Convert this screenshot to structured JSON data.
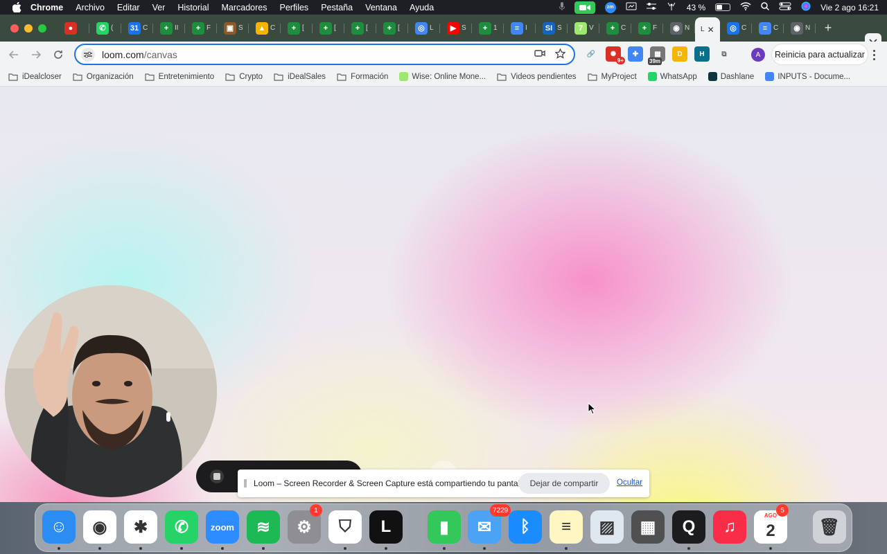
{
  "menubar": {
    "app_name": "Chrome",
    "items": [
      "Archivo",
      "Editar",
      "Ver",
      "Historial",
      "Marcadores",
      "Perfiles",
      "Pestaña",
      "Ventana",
      "Ayuda"
    ],
    "battery": "43 %",
    "battery_level": 0.43,
    "clock": "Vie 2 ago 16:21",
    "zoom_label": "zm"
  },
  "tabs": [
    {
      "glyph": "●",
      "color": "#d93025",
      "label": ""
    },
    {
      "glyph": "✆",
      "color": "#25d366",
      "label": "("
    },
    {
      "glyph": "31",
      "color": "#1a73e8",
      "label": "C"
    },
    {
      "glyph": "+",
      "color": "#1e8e3e",
      "label": "II"
    },
    {
      "glyph": "+",
      "color": "#1e8e3e",
      "label": "F"
    },
    {
      "glyph": "▣",
      "color": "#8a5a2b",
      "label": "S"
    },
    {
      "glyph": "▲",
      "color": "#f4b400",
      "label": "C"
    },
    {
      "glyph": "+",
      "color": "#1e8e3e",
      "label": "["
    },
    {
      "glyph": "+",
      "color": "#1e8e3e",
      "label": "["
    },
    {
      "glyph": "+",
      "color": "#1e8e3e",
      "label": "["
    },
    {
      "glyph": "+",
      "color": "#1e8e3e",
      "label": "["
    },
    {
      "glyph": "◎",
      "color": "#4285f4",
      "label": "L"
    },
    {
      "glyph": "▶",
      "color": "#ff0000",
      "label": "S"
    },
    {
      "glyph": "+",
      "color": "#1e8e3e",
      "label": "1"
    },
    {
      "glyph": "≡",
      "color": "#4285f4",
      "label": "I"
    },
    {
      "glyph": "SI",
      "color": "#1565c0",
      "label": "S"
    },
    {
      "glyph": "7",
      "color": "#9fe870",
      "label": "V"
    },
    {
      "glyph": "+",
      "color": "#1e8e3e",
      "label": "C"
    },
    {
      "glyph": "+",
      "color": "#1e8e3e",
      "label": "F"
    },
    {
      "glyph": "◉",
      "color": "#5f6368",
      "label": "N"
    }
  ],
  "active_tab": {
    "label": "L",
    "close": "✕"
  },
  "tabs_after": [
    {
      "glyph": "◎",
      "color": "#1a73e8",
      "label": "C"
    },
    {
      "glyph": "≡",
      "color": "#4285f4",
      "label": "C"
    },
    {
      "glyph": "◉",
      "color": "#5f6368",
      "label": "N"
    }
  ],
  "address": {
    "host": "loom.com",
    "path": "/canvas"
  },
  "extensions": [
    {
      "glyph": "🔗",
      "color": "#1a73e8",
      "badge": ""
    },
    {
      "glyph": "✺",
      "color": "#d93025",
      "badge": "9+"
    },
    {
      "glyph": "✚",
      "color": "#4285f4",
      "badge": ""
    },
    {
      "glyph": "▦",
      "color": "#777777",
      "badge": "39m"
    },
    {
      "glyph": "D",
      "color": "#f4b400",
      "badge": ""
    },
    {
      "glyph": "H",
      "color": "#0b6e8a",
      "badge": ""
    },
    {
      "glyph": "⧉",
      "color": "#5f6368",
      "badge": ""
    }
  ],
  "profile_initial": "A",
  "update_button": "Reinicia para actualizar",
  "bookmarks": [
    {
      "label": "iDealcloser",
      "type": "folder",
      "color": ""
    },
    {
      "label": "Organización",
      "type": "folder",
      "color": ""
    },
    {
      "label": "Entretenimiento",
      "type": "folder",
      "color": ""
    },
    {
      "label": "Crypto",
      "type": "folder",
      "color": ""
    },
    {
      "label": "iDealSales",
      "type": "folder",
      "color": ""
    },
    {
      "label": "Formación",
      "type": "folder",
      "color": ""
    },
    {
      "label": "Wise: Online Mone...",
      "type": "site",
      "color": "#9fe870"
    },
    {
      "label": "Videos pendientes",
      "type": "folder",
      "color": ""
    },
    {
      "label": "MyProject",
      "type": "folder",
      "color": ""
    },
    {
      "label": "WhatsApp",
      "type": "site",
      "color": "#25d366"
    },
    {
      "label": "Dashlane",
      "type": "site",
      "color": "#0e353d"
    },
    {
      "label": "INPUTS - Docume...",
      "type": "site",
      "color": "#4285f4"
    }
  ],
  "share_notice": {
    "message": "Loom – Screen Recorder & Screen Capture está compartiendo tu pantalla.",
    "stop_button": "Dejar de compartir",
    "hide_link": "Ocultar"
  },
  "dock": [
    {
      "name": "finder-icon",
      "bg": "#2b8cf2",
      "glyph": "☺",
      "badge": "",
      "running": true
    },
    {
      "name": "chrome-icon",
      "bg": "#ffffff",
      "glyph": "◉",
      "badge": "",
      "running": true
    },
    {
      "name": "slack-icon",
      "bg": "#ffffff",
      "glyph": "✱",
      "badge": "",
      "running": true
    },
    {
      "name": "whatsapp-icon",
      "bg": "#25d366",
      "glyph": "✆",
      "badge": "",
      "running": true
    },
    {
      "name": "zoom-icon",
      "bg": "#2d8cff",
      "glyph": "zoom",
      "badge": "",
      "running": true
    },
    {
      "name": "spotify-icon",
      "bg": "#1db954",
      "glyph": "≋",
      "badge": "",
      "running": true
    },
    {
      "name": "system-settings-icon",
      "bg": "#8e8e93",
      "glyph": "⚙",
      "badge": "1",
      "running": false
    },
    {
      "name": "security-shield-icon",
      "bg": "#ffffff",
      "glyph": "⛉",
      "badge": "",
      "running": true
    },
    {
      "name": "loom-app-icon",
      "bg": "#111111",
      "glyph": "L",
      "badge": "",
      "running": true
    },
    {
      "name": "numbers-icon",
      "bg": "#34c759",
      "glyph": "▮",
      "badge": "",
      "running": true
    },
    {
      "name": "mail-icon",
      "bg": "#4aa3f5",
      "glyph": "✉",
      "badge": "7229",
      "running": true
    },
    {
      "name": "bluetooth-icon",
      "bg": "#1a8cff",
      "glyph": "ᛒ",
      "badge": "",
      "running": false
    },
    {
      "name": "notes-icon",
      "bg": "#fff6c2",
      "glyph": "≡",
      "badge": "",
      "running": true
    },
    {
      "name": "preview-icon",
      "bg": "#dfe8f0",
      "glyph": "▨",
      "badge": "",
      "running": false
    },
    {
      "name": "calculator-icon",
      "bg": "#505050",
      "glyph": "▦",
      "badge": "",
      "running": false
    },
    {
      "name": "quicktime-icon",
      "bg": "#1c1c1e",
      "glyph": "Q",
      "badge": "",
      "running": true
    },
    {
      "name": "music-icon",
      "bg": "#fa2d48",
      "glyph": "♫",
      "badge": "",
      "running": false
    },
    {
      "name": "calendar-icon",
      "bg": "#ffffff",
      "glyph": "2",
      "badge": "5",
      "running": true
    },
    {
      "name": "trash-icon",
      "bg": "#cfd3d8",
      "glyph": "🗑",
      "badge": "",
      "running": false
    }
  ],
  "calendar_month": "AGO"
}
